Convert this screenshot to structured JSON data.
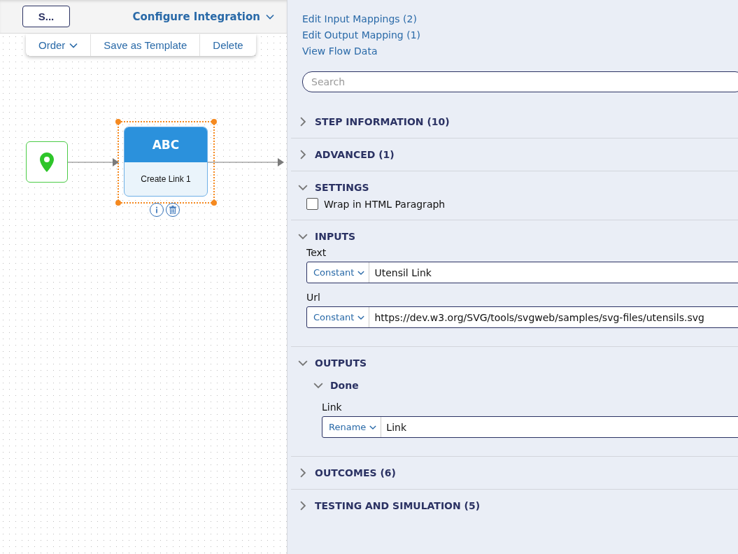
{
  "header": {
    "title_button": "S...",
    "menu": "Configure Integration"
  },
  "toolbar": [
    {
      "label": "Order",
      "dropdown": true
    },
    {
      "label": "Save as Template",
      "dropdown": false
    },
    {
      "label": "Delete",
      "dropdown": false
    }
  ],
  "canvas": {
    "step": {
      "icon_text": "ABC",
      "label": "Create Link 1",
      "selected": true
    }
  },
  "links": [
    "Edit Input Mappings (2)",
    "Edit Output Mapping (1)",
    "View Flow Data"
  ],
  "search": {
    "placeholder": "Search"
  },
  "sections": [
    {
      "kind": "group",
      "title": "STEP INFORMATION (10)",
      "expanded": false
    },
    {
      "kind": "group",
      "title": "ADVANCED (1)",
      "expanded": false
    },
    {
      "kind": "settings",
      "title": "SETTINGS",
      "expanded": true,
      "options": [
        {
          "label": "Wrap in HTML Paragraph",
          "checked": false
        }
      ]
    },
    {
      "kind": "inputs",
      "title": "INPUTS",
      "expanded": true,
      "fields": [
        {
          "label": "Text",
          "mode": "Constant",
          "value": "Utensil Link"
        },
        {
          "label": "Url",
          "mode": "Constant",
          "value": "https://dev.w3.org/SVG/tools/svgweb/samples/svg-files/utensils.svg"
        }
      ]
    },
    {
      "kind": "outputs",
      "title": "OUTPUTS",
      "expanded": true,
      "groups": [
        {
          "title": "Done",
          "expanded": true,
          "fields": [
            {
              "label": "Link",
              "mode": "Rename",
              "value": "Link"
            }
          ]
        }
      ]
    },
    {
      "kind": "group",
      "title": "OUTCOMES (6)",
      "expanded": false
    },
    {
      "kind": "group",
      "title": "TESTING AND SIMULATION (5)",
      "expanded": false
    }
  ]
}
